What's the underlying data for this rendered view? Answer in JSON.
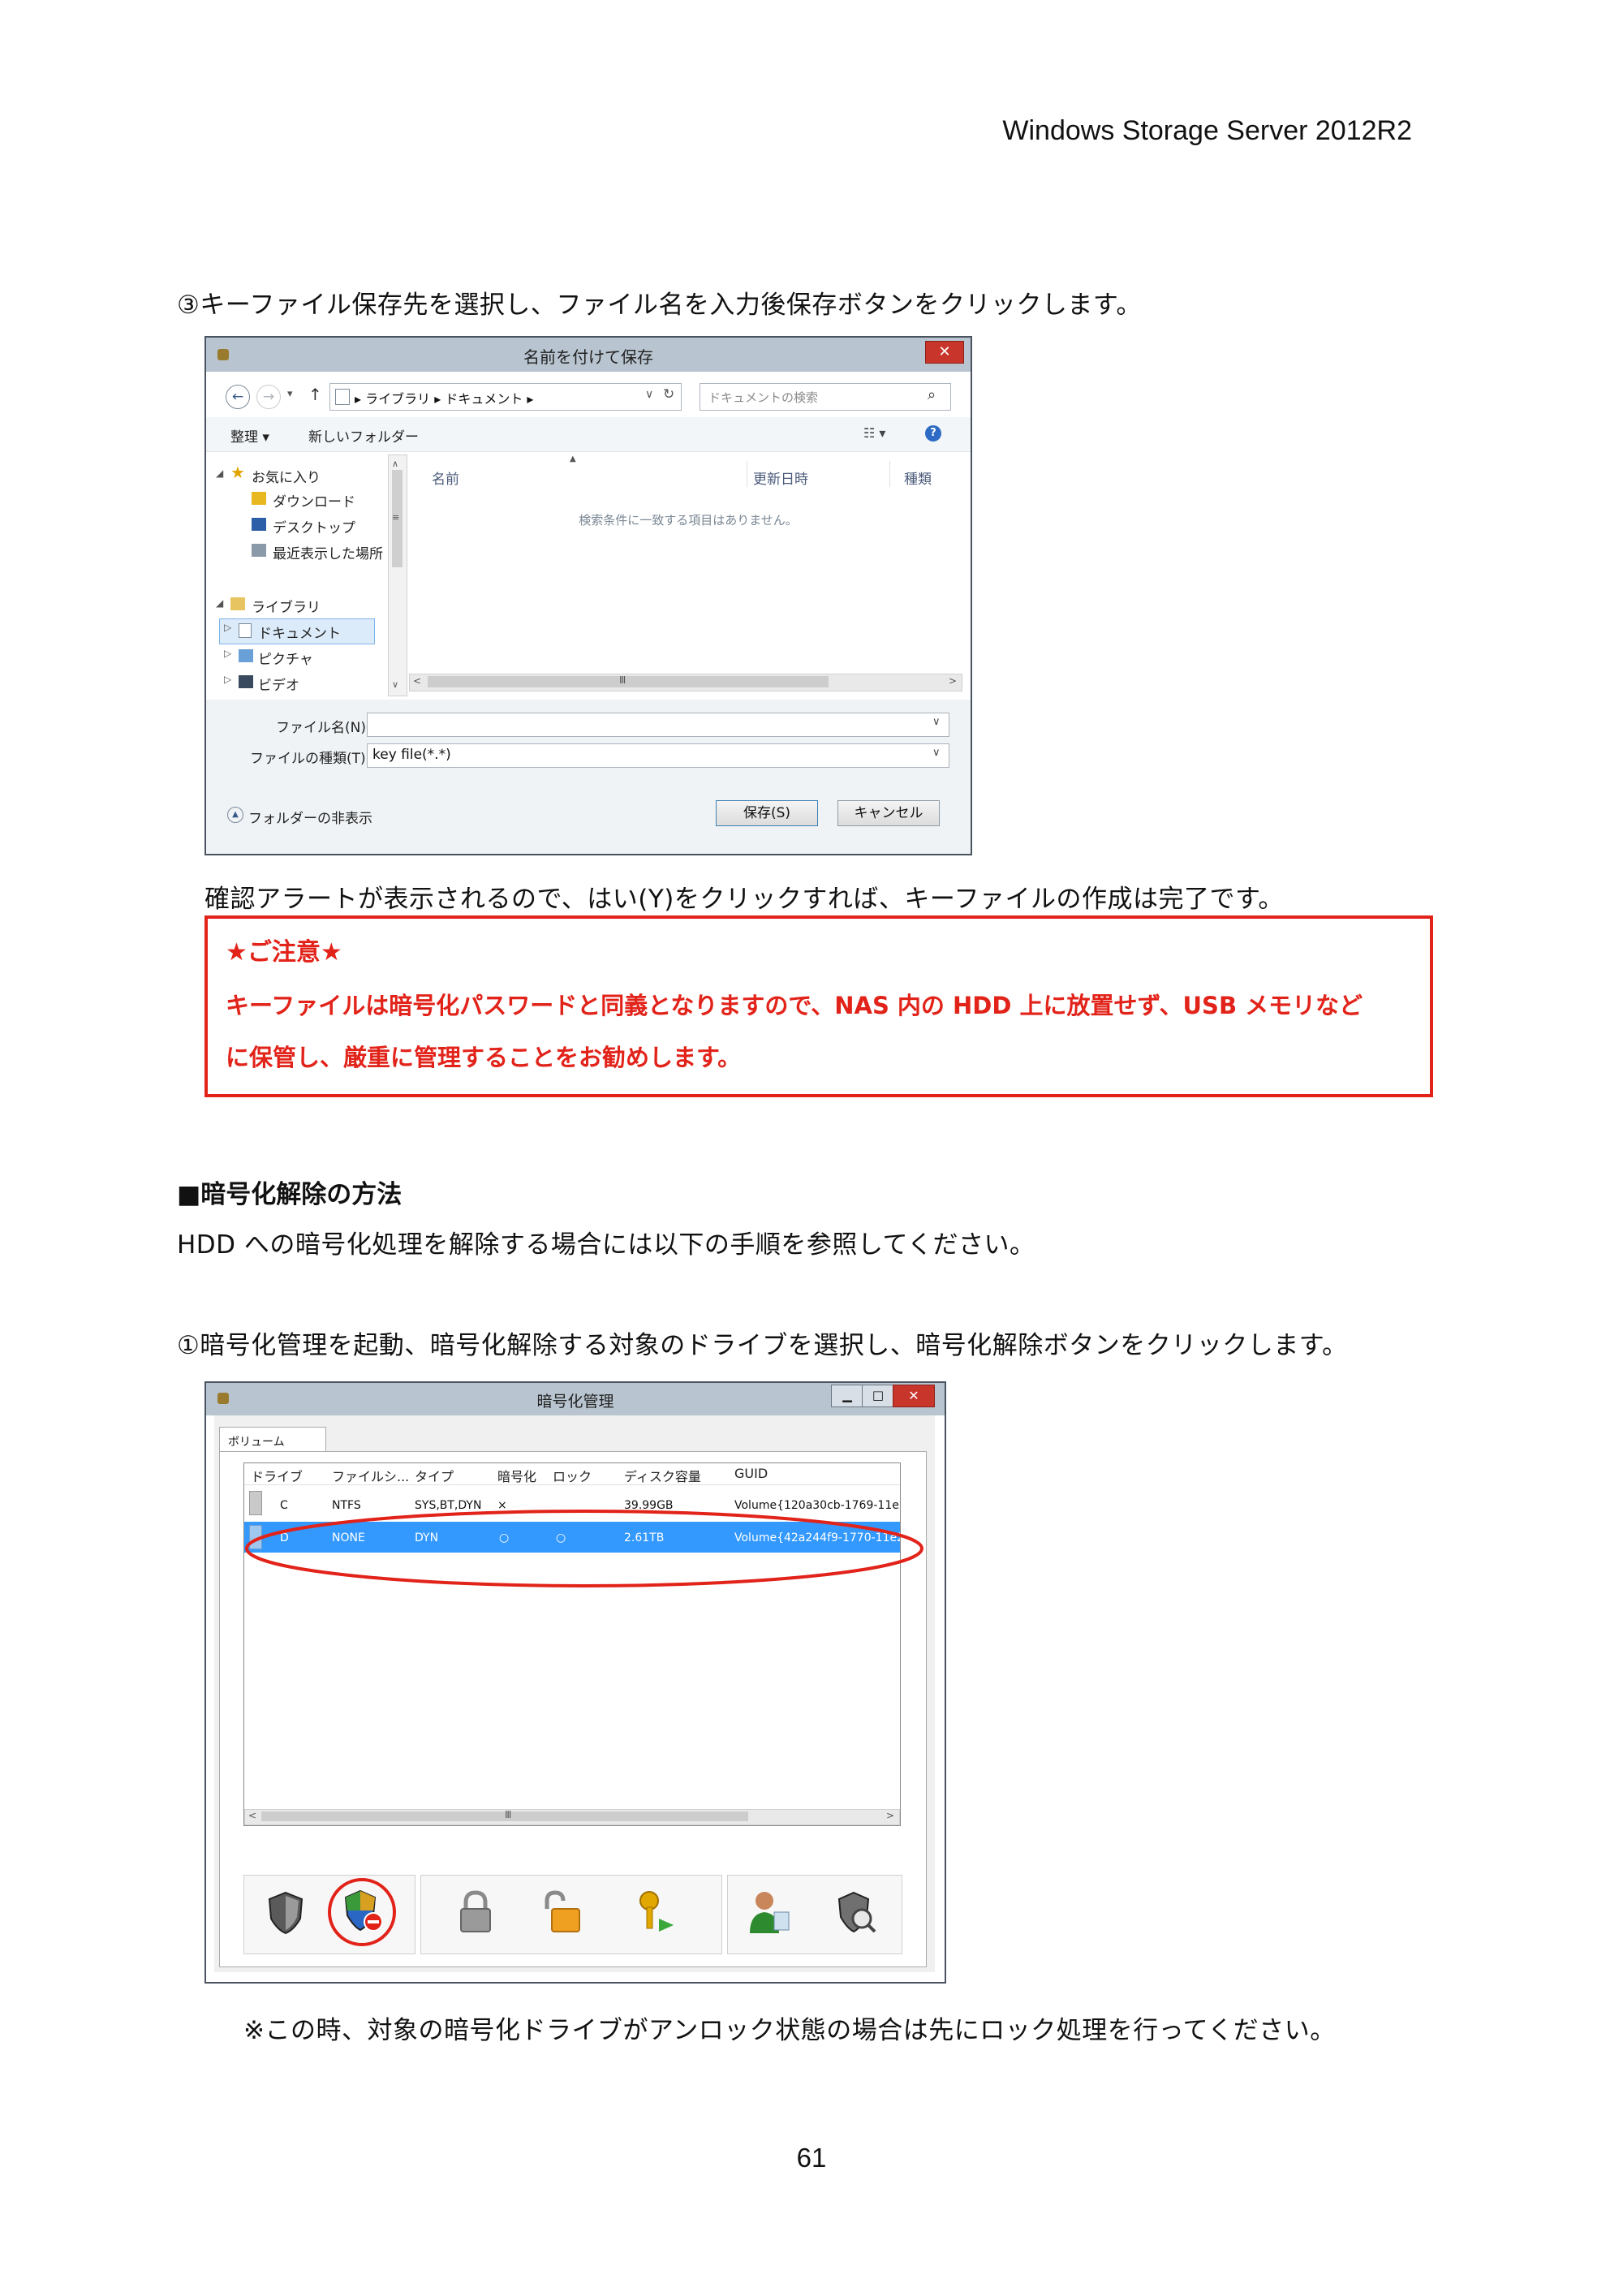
{
  "header": {
    "product": "Windows Storage Server 2012R2"
  },
  "step3": {
    "text": "③キーファイル保存先を選択し、ファイル名を入力後保存ボタンをクリックします。"
  },
  "save_dialog": {
    "title": "名前を付けて保存",
    "close": "✕",
    "nav_back": "←",
    "nav_forward": "→",
    "nav_up": "↑",
    "breadcrumb": "▸ ライブラリ ▸ ドキュメント ▸",
    "search_placeholder": "ドキュメントの検索",
    "toolbar": {
      "organize": "整理 ▾",
      "new_folder": "新しいフォルダー"
    },
    "nav": {
      "favorites": "お気に入り",
      "downloads": "ダウンロード",
      "desktop": "デスクトップ",
      "recent": "最近表示した場所",
      "libraries": "ライブラリ",
      "documents": "ドキュメント",
      "pictures": "ピクチャ",
      "videos": "ビデオ"
    },
    "columns": {
      "name": "名前",
      "modified": "更新日時",
      "type": "種類"
    },
    "empty_message": "検索条件に一致する項目はありません。",
    "filename_label": "ファイル名(N):",
    "filename_value": "",
    "filetype_label": "ファイルの種類(T):",
    "filetype_value": "key file(*.*)",
    "hide_folders": "フォルダーの非表示",
    "save_button": "保存(S)",
    "cancel_button": "キャンセル",
    "hscroll_mid": "Ⅲ"
  },
  "confirm_text": "確認アラートが表示されるので、はい(Y)をクリックすれば、キーファイルの作成は完了です。",
  "notice": {
    "title": "★ご注意★",
    "line1": "キーファイルは暗号化パスワードと同義となりますので、NAS 内の HDD 上に放置せず、USB メモリなど",
    "line2": "に保管し、厳重に管理することをお勧めします。"
  },
  "section": {
    "heading": "■暗号化解除の方法",
    "intro": "HDD への暗号化処理を解除する場合には以下の手順を参照してください。"
  },
  "step1": {
    "text": "①暗号化管理を起動、暗号化解除する対象のドライブを選択し、暗号化解除ボタンをクリックします。"
  },
  "manager": {
    "title": "暗号化管理",
    "tab": "ボリューム",
    "minimize": "▁",
    "maximize": "□",
    "close": "✕",
    "columns": [
      "ドライブ",
      "ファイルシ...",
      "タイプ",
      "暗号化",
      "ロック",
      "ディスク容量",
      "GUID"
    ],
    "rows": [
      [
        "C",
        "NTFS",
        "SYS,BT,DYN",
        "×",
        "",
        "39.99GB",
        "Volume{120a30cb-1769-11e2-"
      ],
      [
        "D",
        "NONE",
        "DYN",
        "○",
        "○",
        "2.61TB",
        "Volume{42a244f9-1770-11e2-"
      ]
    ],
    "hscroll_mid": "Ⅲ",
    "tools": [
      "encrypt-icon",
      "decrypt-icon",
      "lock-icon",
      "unlock-icon",
      "key-icon",
      "user-icon",
      "check-icon"
    ],
    "accent_selected": "#3399ff",
    "highlight_color": "#e2231a"
  },
  "footnote": "※この時、対象の暗号化ドライブがアンロック状態の場合は先にロック処理を行ってください。",
  "page_number": "61"
}
